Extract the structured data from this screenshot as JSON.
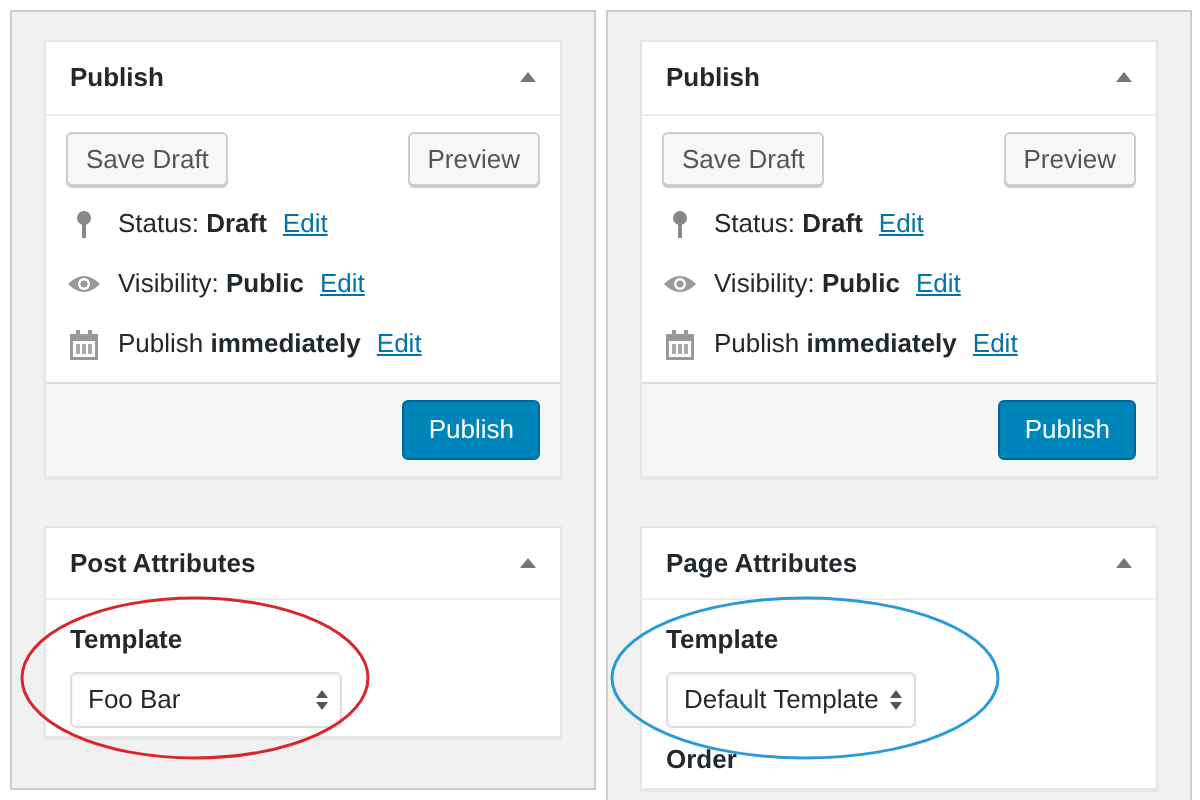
{
  "panels": [
    {
      "publish_box": {
        "title": "Publish",
        "save_draft": "Save Draft",
        "preview": "Preview",
        "rows": [
          {
            "kind": "status",
            "text": "Status: **Draft**",
            "link": "Edit"
          },
          {
            "kind": "visibility",
            "text": "Visibility: **Public**",
            "link": "Edit"
          },
          {
            "kind": "schedule",
            "text": "Publish **immediately**",
            "link": "Edit"
          }
        ],
        "publish": "Publish"
      },
      "attributes_box": {
        "title": "Post Attributes",
        "template_label": "Template",
        "template_value": "Foo Bar",
        "annotation": {
          "color": "#d9262b"
        }
      }
    },
    {
      "publish_box": {
        "title": "Publish",
        "save_draft": "Save Draft",
        "preview": "Preview",
        "rows": [
          {
            "kind": "status",
            "text": "Status: **Draft**",
            "link": "Edit"
          },
          {
            "kind": "visibility",
            "text": "Visibility: **Public**",
            "link": "Edit"
          },
          {
            "kind": "schedule",
            "text": "Publish **immediately**",
            "link": "Edit"
          }
        ],
        "publish": "Publish"
      },
      "attributes_box": {
        "title": "Page Attributes",
        "template_label": "Template",
        "template_value": "Default Template",
        "annotation": {
          "color": "#2a9bd6"
        },
        "order_label": "Order"
      }
    }
  ]
}
